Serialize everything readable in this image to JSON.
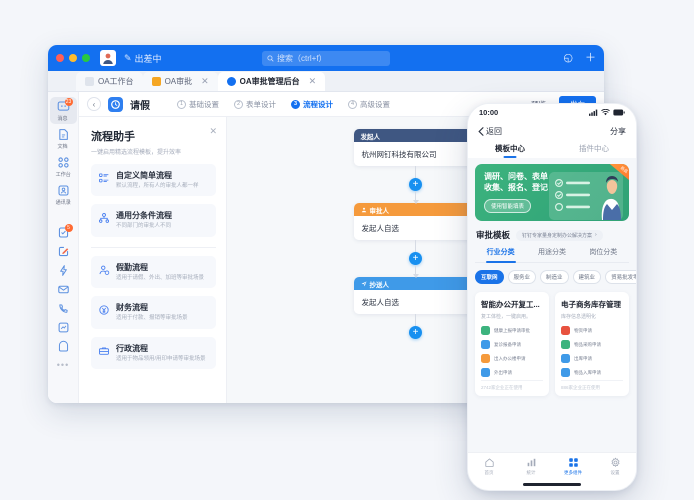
{
  "desktop": {
    "titlebar": {
      "status_text": "出差中",
      "search_placeholder": "搜索（ctrl+f）",
      "history_icon": "history-icon",
      "add_icon": "plus-icon"
    },
    "tabs": [
      {
        "label": "OA工作台",
        "closable": false,
        "active": false
      },
      {
        "label": "OA审批",
        "closable": true,
        "active": false
      },
      {
        "label": "OA审批管理后台",
        "closable": true,
        "active": true
      }
    ],
    "rail": [
      {
        "label": "消息",
        "icon": "message-icon",
        "badge": "23",
        "selected": true
      },
      {
        "label": "文档",
        "icon": "document-icon",
        "badge": "",
        "selected": false
      },
      {
        "label": "工作台",
        "icon": "workbench-icon",
        "badge": "",
        "selected": false
      },
      {
        "label": "通讯录",
        "icon": "contacts-icon",
        "badge": "",
        "selected": false
      }
    ],
    "rail_extra": [
      {
        "icon": "approval-icon",
        "badge": "5"
      },
      {
        "icon": "edit-icon",
        "badge": ""
      },
      {
        "icon": "lightning-icon",
        "badge": ""
      },
      {
        "icon": "mail-icon",
        "badge": ""
      },
      {
        "icon": "phone-icon",
        "badge": ""
      },
      {
        "icon": "report-icon",
        "badge": ""
      },
      {
        "icon": "clock-icon",
        "badge": ""
      }
    ],
    "rail_more": "•••",
    "header": {
      "back_icon": "chevron-left-icon",
      "app_icon": "clock-app-icon",
      "title": "请假",
      "steps": [
        {
          "num": "1",
          "label": "基础设置",
          "active": false
        },
        {
          "num": "2",
          "label": "表单设计",
          "active": false
        },
        {
          "num": "3",
          "label": "流程设计",
          "active": true
        },
        {
          "num": "4",
          "label": "高级设置",
          "active": false
        }
      ],
      "preview_label": "预览",
      "publish_label": "发布"
    },
    "assistant": {
      "title": "流程助手",
      "subtitle": "一键启用精选流程模板，提升效率",
      "close_icon": "close-icon",
      "items": [
        {
          "icon": "list-icon",
          "title": "自定义简单流程",
          "desc": "默认流程，所有人的审批人都一样",
          "color": "#4a80f0"
        },
        {
          "icon": "branch-icon",
          "title": "通用分条件流程",
          "desc": "不同部门的审批人不同",
          "color": "#4a80f0"
        },
        {
          "icon": "attendance-icon",
          "title": "假勤流程",
          "desc": "适用于请假、外出、加班等审批场景",
          "color": "#4a80f0"
        },
        {
          "icon": "finance-icon",
          "title": "财务流程",
          "desc": "适用于付款、报销等审批场景",
          "color": "#4a80f0"
        },
        {
          "icon": "admin-icon",
          "title": "行政流程",
          "desc": "适用于物品领用/用印申请等审批场景",
          "color": "#4a80f0"
        }
      ]
    },
    "flow": {
      "plus_label": "+",
      "nodes": [
        {
          "header": "发起人",
          "header_icon": "",
          "header_color": "#3f5782",
          "value": "杭州网钉科技有限公司"
        },
        {
          "header": "审批人",
          "header_icon": "approver-icon",
          "header_color": "#f59a3c",
          "value": "发起人自选"
        },
        {
          "header": "抄送人",
          "header_icon": "cc-icon",
          "header_color": "#3f9ae8",
          "value": "发起人自选"
        }
      ]
    }
  },
  "phone": {
    "status": {
      "time": "10:00",
      "signal_icon": "signal-icon",
      "wifi_icon": "wifi-icon",
      "battery_icon": "battery-icon"
    },
    "nav": {
      "back_label": "返回",
      "back_icon": "chevron-left-icon",
      "share_label": "分享"
    },
    "tabs": [
      {
        "label": "模板中心",
        "active": true
      },
      {
        "label": "插件中心",
        "active": false
      }
    ],
    "banner": {
      "line1": "调研、问卷、表单",
      "line2": "收集、报名、登记",
      "button": "使用智能填表",
      "corner_badge": "新品",
      "color": "#35a97a"
    },
    "section": {
      "title": "审批模板",
      "pill": "钉钉专家量身定制办公解决方案",
      "pill_arrow": "›"
    },
    "cat_tabs": [
      {
        "label": "行业分类",
        "active": true
      },
      {
        "label": "用途分类",
        "active": false
      },
      {
        "label": "岗位分类",
        "active": false
      }
    ],
    "chips": [
      {
        "label": "互联网",
        "active": true
      },
      {
        "label": "服务业",
        "active": false
      },
      {
        "label": "制造业",
        "active": false
      },
      {
        "label": "建筑业",
        "active": false
      },
      {
        "label": "贸易批发零售",
        "active": false
      }
    ],
    "template_cards": [
      {
        "title": "智能办公开复工...",
        "subtitle": "复工体检，一键启用。",
        "items": [
          {
            "label": "健康上报申请审批",
            "color": "#3cb37e"
          },
          {
            "label": "复诊报备申请",
            "color": "#3f9ae8"
          },
          {
            "label": "出入办公楼申请",
            "color": "#f59a3c"
          },
          {
            "label": "外出申请",
            "color": "#3f9ae8"
          }
        ],
        "footer": "2742家企业正在使用"
      },
      {
        "title": "电子商务库存管理",
        "subtitle": "库存信息透明化",
        "items": [
          {
            "label": "物资申请",
            "color": "#e8523f"
          },
          {
            "label": "物品采购申请",
            "color": "#3cb37e"
          },
          {
            "label": "出库申请",
            "color": "#3f9ae8"
          },
          {
            "label": "物品入库申请",
            "color": "#3f9ae8"
          }
        ],
        "footer": "886家企业正在使用"
      }
    ],
    "bottom_nav": [
      {
        "label": "首页",
        "icon": "home-icon",
        "active": false
      },
      {
        "label": "统计",
        "icon": "chart-icon",
        "active": false
      },
      {
        "label": "更多组件",
        "icon": "grid-icon",
        "active": true
      },
      {
        "label": "设置",
        "icon": "gear-icon",
        "active": false
      }
    ]
  }
}
